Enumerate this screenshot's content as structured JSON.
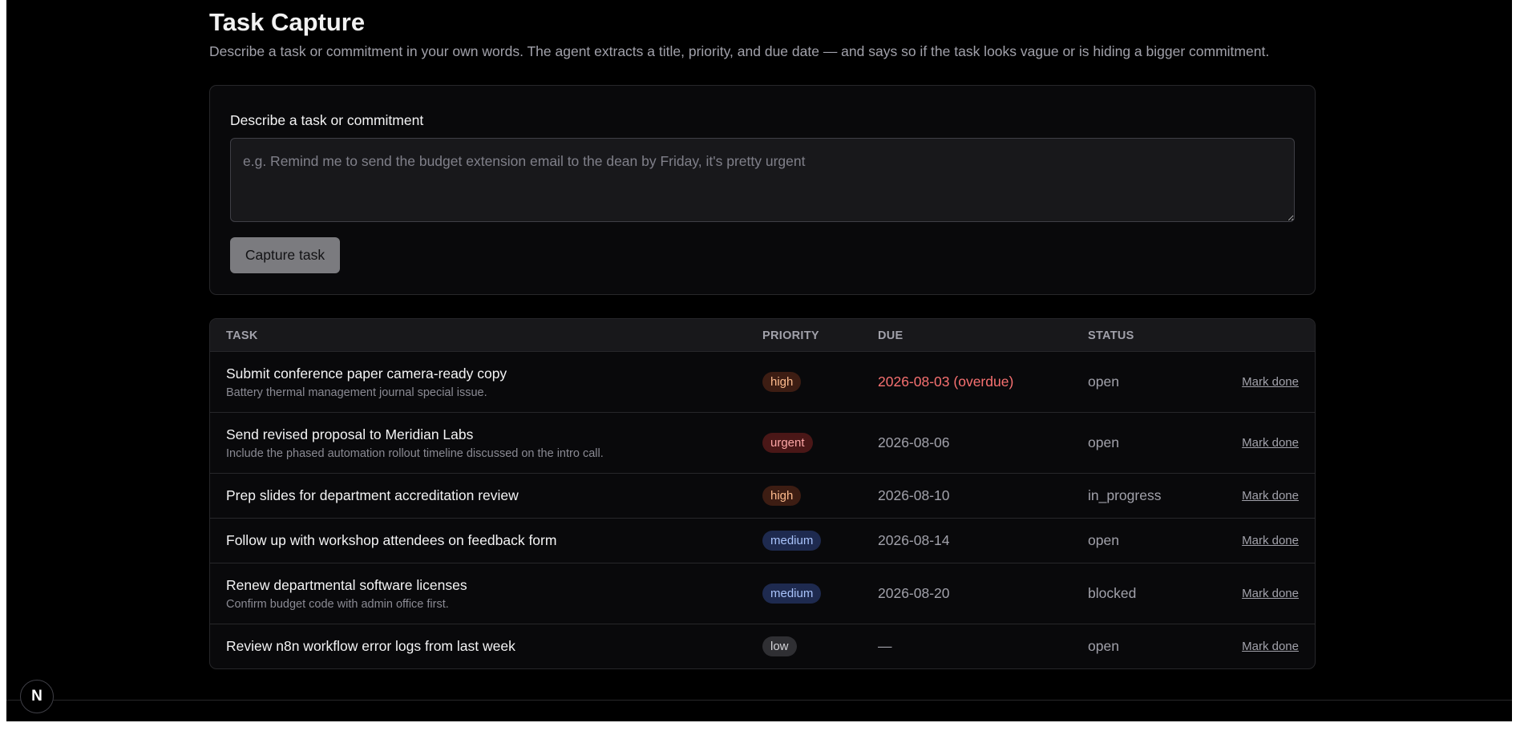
{
  "page": {
    "title": "Task Capture",
    "subtitle": "Describe a task or commitment in your own words. The agent extracts a title, priority, and due date — and says so if the task looks vague or is hiding a bigger commitment."
  },
  "capture": {
    "label": "Describe a task or commitment",
    "placeholder": "e.g. Remind me to send the budget extension email to the dean by Friday, it's pretty urgent",
    "value": "",
    "button_label": "Capture task"
  },
  "table": {
    "headers": {
      "task": "TASK",
      "priority": "PRIORITY",
      "due": "DUE",
      "status": "STATUS"
    },
    "rows": [
      {
        "title": "Submit conference paper camera-ready copy",
        "note": "Battery thermal management journal special issue.",
        "priority": "high",
        "due": "2026-08-03 (overdue)",
        "status": "open",
        "action": "Mark done"
      },
      {
        "title": "Send revised proposal to Meridian Labs",
        "note": "Include the phased automation rollout timeline discussed on the intro call.",
        "priority": "urgent",
        "due": "2026-08-06",
        "status": "open",
        "action": "Mark done"
      },
      {
        "title": "Prep slides for department accreditation review",
        "note": "",
        "priority": "high",
        "due": "2026-08-10",
        "status": "in_progress",
        "action": "Mark done"
      },
      {
        "title": "Follow up with workshop attendees on feedback form",
        "note": "",
        "priority": "medium",
        "due": "2026-08-14",
        "status": "open",
        "action": "Mark done"
      },
      {
        "title": "Renew departmental software licenses",
        "note": "Confirm budget code with admin office first.",
        "priority": "medium",
        "due": "2026-08-20",
        "status": "blocked",
        "action": "Mark done"
      },
      {
        "title": "Review n8n workflow error logs from last week",
        "note": "",
        "priority": "low",
        "due": "—",
        "status": "open",
        "action": "Mark done"
      }
    ]
  },
  "next_badge": {
    "letter": "N",
    "icon": "nextjs-logo-icon"
  },
  "colors": {
    "background": "#000000",
    "card": "#09090b",
    "border": "#27272a",
    "overdue": "#f87171",
    "priority_high": "#fdba8c",
    "priority_urgent": "#fca5a5",
    "priority_medium": "#a9c3fb",
    "priority_low": "#d4d4d8"
  }
}
